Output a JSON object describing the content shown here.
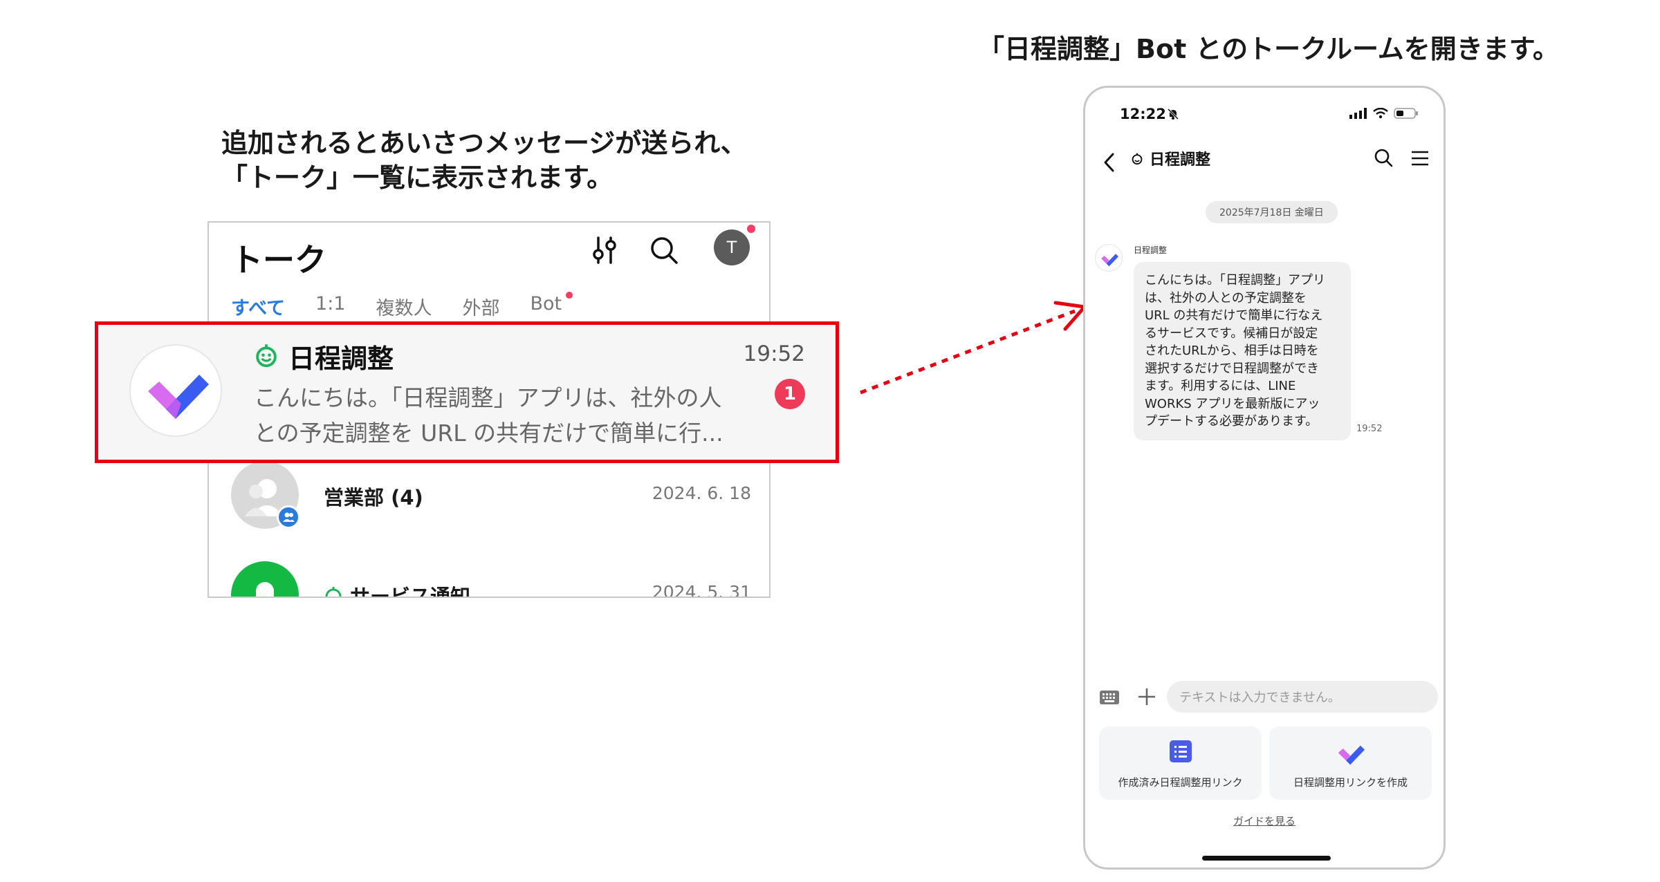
{
  "captions": {
    "left_line1": "追加されるとあいさつメッセージが送られ、",
    "left_line2": "「トーク」一覧に表示されます。",
    "right": "「日程調整」Bot とのトークルームを開きます。"
  },
  "talk_list": {
    "title": "トーク",
    "avatar_initial": "T",
    "tabs": [
      "すべて",
      "1:1",
      "複数人",
      "外部",
      "Bot"
    ],
    "highlighted": {
      "name": "日程調整",
      "time": "19:52",
      "preview_line1": "こんにちは。「日程調整」アプリは、社外の人",
      "preview_line2": "との予定調整を URL の共有だけで簡単に行...",
      "unread": "1"
    },
    "rows": [
      {
        "name": "営業部 (4)",
        "date": "2024. 6. 18"
      },
      {
        "name": "サービス通知",
        "date": "2024. 5. 31"
      }
    ]
  },
  "phone": {
    "status_time": "12:22",
    "chat_title": "日程調整",
    "date_pill": "2025年7月18日 金曜日",
    "sender": "日程調整",
    "message_lines": [
      "こんにちは。「日程調整」アプリ",
      "は、社外の人との予定調整を",
      "URL の共有だけで簡単に行なえ",
      "るサービスです。候補日が設定",
      "されたURLから、相手は日時を",
      "選択するだけで日程調整ができ",
      "ます。利用するには、LINE",
      "WORKS アプリを最新版にアッ",
      "プデートする必要があります。"
    ],
    "message_time": "19:52",
    "input_placeholder": "テキストは入力できません。",
    "actions": [
      "作成済み日程調整用リンク",
      "日程調整用リンクを作成"
    ],
    "guide": "ガイドを見る"
  },
  "colors": {
    "highlight_border": "#e60012",
    "active_tab": "#2a7bdc",
    "unread_badge": "#f03a5a",
    "bot_icon": "#20b45a",
    "logo_purple": "#d96bf0",
    "logo_blue": "#3a5cf0"
  },
  "icons": [
    "filter-icon",
    "search-icon",
    "bot-icon",
    "group-icon",
    "back-icon",
    "menu-icon",
    "keyboard-icon",
    "plus-icon",
    "list-icon",
    "check-logo-icon",
    "bell-off-icon",
    "signal-icon",
    "wifi-icon",
    "battery-icon"
  ]
}
